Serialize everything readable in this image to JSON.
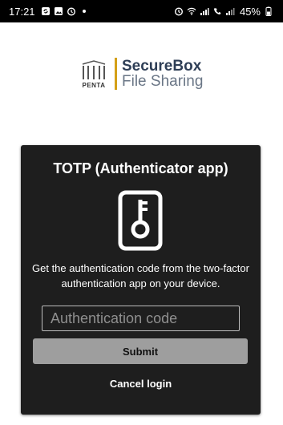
{
  "status_bar": {
    "time": "17:21",
    "battery": "45%",
    "left_icons": [
      "sync-icon",
      "image-icon",
      "alarm-icon"
    ],
    "right_icons": [
      "alarm-icon",
      "wifi-icon",
      "signal-icon",
      "wifi-calling-icon",
      "signal-icon",
      "battery-icon"
    ]
  },
  "logo": {
    "brand": "PENTA",
    "title": "SecureBox",
    "subtitle": "File Sharing",
    "accent_color": "#d4a017"
  },
  "card": {
    "title": "TOTP (Authenticator app)",
    "icon": "phone-key-icon",
    "description": "Get the authentication code from the two-factor authentication app on your device.",
    "input_placeholder": "Authentication code",
    "input_value": "",
    "submit_label": "Submit",
    "cancel_label": "Cancel login"
  }
}
